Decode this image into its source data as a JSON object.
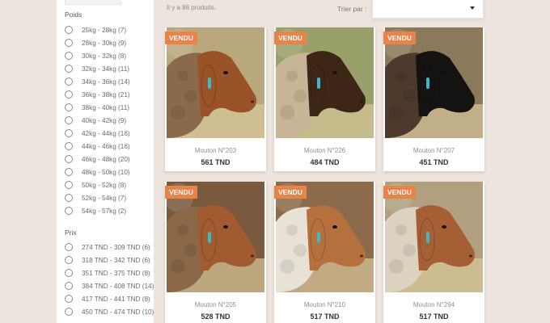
{
  "sidebar": {
    "weight_title": "Poids",
    "weight_options": [
      "25kg - 28kg (7)",
      "28kg - 30kg (9)",
      "30kg - 32kg (8)",
      "32kg - 34kg (11)",
      "34kg - 36kg (14)",
      "36kg - 38kg (21)",
      "38kg - 40kg (11)",
      "40kg - 42kg (9)",
      "42kg - 44kg (16)",
      "44kg - 46kg (16)",
      "46kg - 48kg (20)",
      "48kg - 50kg (10)",
      "50kg - 52kg (8)",
      "52kg - 54kg (7)",
      "54kg - 57kg (2)"
    ],
    "price_title": "Prix",
    "price_options": [
      "274 TND - 309 TND (6)",
      "318 TND - 342 TND (6)",
      "351 TND - 375 TND (8)",
      "384 TND - 408 TND (14)",
      "417 TND - 441 TND (8)",
      "450 TND - 474 TND (10)"
    ]
  },
  "listing": {
    "count_text": "Il y a 86 produits.",
    "sort_label": "Trier par :",
    "sort_value": ""
  },
  "products": [
    {
      "badge": "VENDU",
      "name": "Mouton N°203",
      "price": "561 TND",
      "fleece": "#8a6a4a",
      "face": "#9a5228",
      "bg": "#b9a77e"
    },
    {
      "badge": "VENDU",
      "name": "Mouton N°226",
      "price": "484 TND",
      "fleece": "#c8b496",
      "face": "#3e2616",
      "bg": "#9aa06a"
    },
    {
      "badge": "VENDU",
      "name": "Mouton N°207",
      "price": "451 TND",
      "fleece": "#4d3a2c",
      "face": "#151311",
      "bg": "#8a7a5a"
    },
    {
      "badge": "VENDU",
      "name": "Mouton N°205",
      "price": "528 TND",
      "fleece": "#8a6848",
      "face": "#a25a30",
      "bg": "#7a5a3e"
    },
    {
      "badge": "VENDU",
      "name": "Mouton N°210",
      "price": "517 TND",
      "fleece": "#e8e2d6",
      "face": "#b5703e",
      "bg": "#8c6a4c"
    },
    {
      "badge": "VENDU",
      "name": "Mouton N°294",
      "price": "517 TND",
      "fleece": "#ddd2c0",
      "face": "#a65e34",
      "bg": "#b0a080"
    }
  ],
  "colors": {
    "page_bg": "#ede4dd",
    "badge_bg": "#e8844a",
    "ear_tag": "#3fb7c9"
  }
}
